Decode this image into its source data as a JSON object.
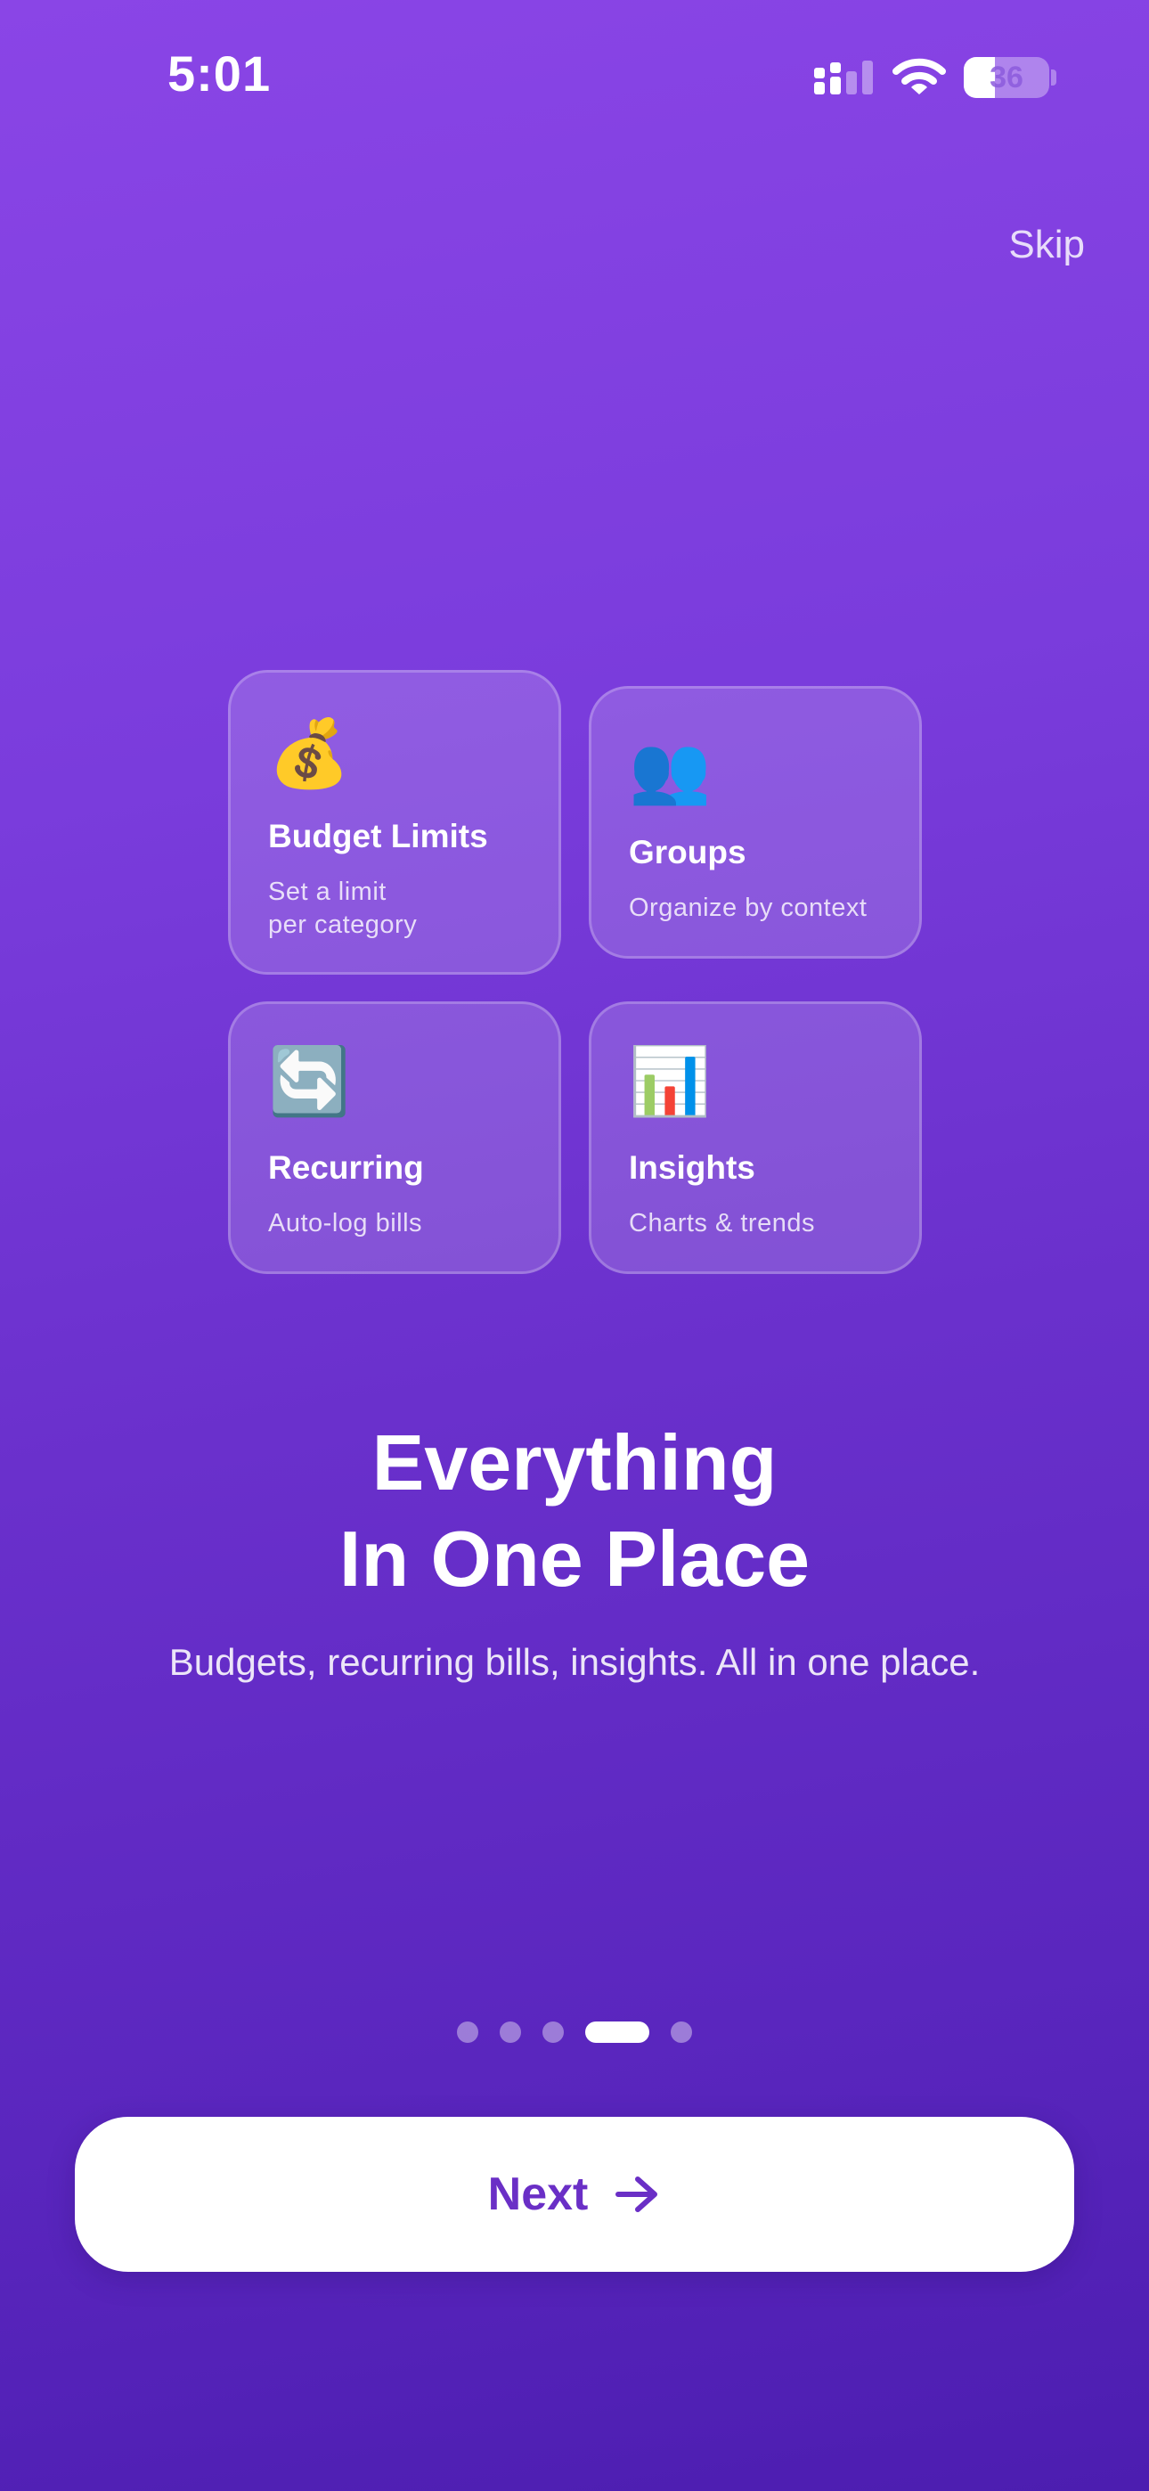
{
  "status_bar": {
    "time": "5:01",
    "battery_level": "36",
    "battery_fraction": 0.36,
    "icons": [
      "cellular-signal-icon",
      "wifi-icon",
      "battery-icon"
    ]
  },
  "skip_label": "Skip",
  "cards": [
    {
      "emoji": "💰",
      "icon": "money-bag-icon",
      "title": "Budget Limits",
      "desc_line1": "Set a limit",
      "desc_line2": "per category"
    },
    {
      "emoji": "👥",
      "icon": "people-icon",
      "title": "Groups",
      "desc_line1": "Organize by context",
      "desc_line2": ""
    },
    {
      "emoji": "🔄",
      "icon": "recurring-arrows-icon",
      "title": "Recurring",
      "desc_line1": "Auto-log bills",
      "desc_line2": ""
    },
    {
      "emoji": "📊",
      "icon": "bar-chart-icon",
      "title": "Insights",
      "desc_line1": "Charts & trends",
      "desc_line2": ""
    }
  ],
  "headline": {
    "line1": "Everything",
    "line2": "In One Place"
  },
  "subtitle": "Budgets, recurring bills, insights. All in one place.",
  "pagination": {
    "total": 5,
    "current": 4
  },
  "next_button": {
    "label": "Next",
    "icon": "arrow-right-icon"
  },
  "colors": {
    "background_top": "#8a45e6",
    "background_bottom": "#4c1db0",
    "accent": "#6a2fc6",
    "button_bg": "#ffffff"
  }
}
